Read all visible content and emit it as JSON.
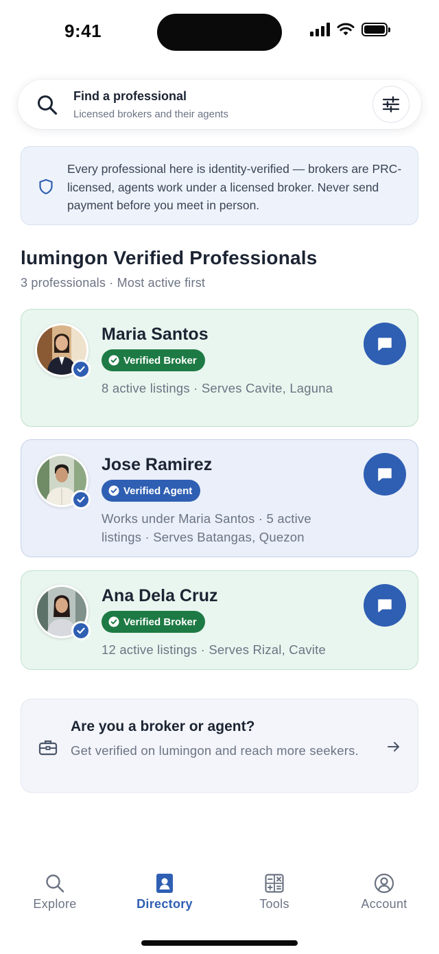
{
  "status_bar": {
    "time": "9:41"
  },
  "search": {
    "title": "Find a professional",
    "subtitle": "Licensed brokers and their agents",
    "icon": "search-icon",
    "filter_icon": "sliders-icon"
  },
  "notice": {
    "icon": "shield-icon",
    "text": "Every professional here is identity-verified — brokers are PRC-licensed, agents work under a licensed broker. Never send payment before you meet in person."
  },
  "directory": {
    "title": "lumingon Verified Professionals",
    "subtitle": "3 professionals · Most active first",
    "professionals": [
      {
        "name": "Maria Santos",
        "badge": "Verified Broker",
        "role": "broker",
        "description": "8 active listings · Serves Cavite, Laguna"
      },
      {
        "name": "Jose Ramirez",
        "badge": "Verified Agent",
        "role": "agent",
        "description": "Works under Maria Santos · 5 active listings · Serves Batangas, Quezon"
      },
      {
        "name": "Ana Dela Cruz",
        "badge": "Verified Broker",
        "role": "broker",
        "description": "12 active listings · Serves Rizal, Cavite"
      }
    ]
  },
  "cta": {
    "icon": "briefcase-icon",
    "title": "Are you a broker or agent?",
    "text": "Get verified on lumingon and reach more seekers.",
    "arrow_icon": "arrow-right-icon"
  },
  "tabs": [
    {
      "label": "Explore",
      "icon": "search-icon",
      "active": false
    },
    {
      "label": "Directory",
      "icon": "id-card-icon",
      "active": true
    },
    {
      "label": "Tools",
      "icon": "calculator-icon",
      "active": false
    },
    {
      "label": "Account",
      "icon": "user-circle-icon",
      "active": false
    }
  ],
  "colors": {
    "accent": "#2f5fb3",
    "broker_green": "#1e7a44",
    "broker_card": "#e9f6ef",
    "agent_card": "#eaeff9"
  }
}
